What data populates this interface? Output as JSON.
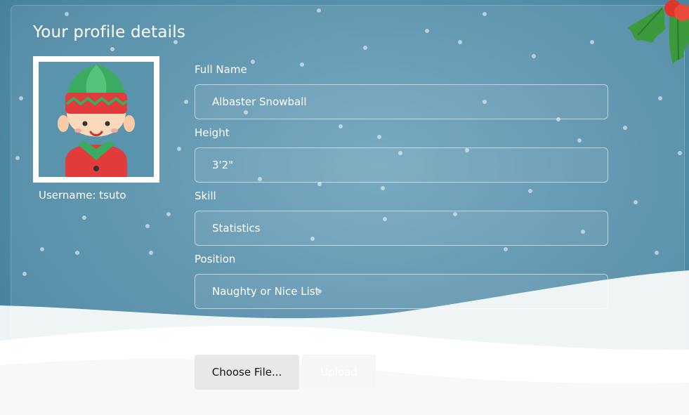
{
  "page": {
    "title": "Your profile details",
    "username_label": "Username: tsuto"
  },
  "avatar": {
    "icon": "elf-icon"
  },
  "fields": [
    {
      "label": "Full Name",
      "value": "Albaster Snowball"
    },
    {
      "label": "Height",
      "value": "3'2\""
    },
    {
      "label": "Skill",
      "value": "Statistics"
    },
    {
      "label": "Position",
      "value": "Naughty or Nice List"
    }
  ],
  "buttons": {
    "choose_file": "Choose File...",
    "upload": "Upload"
  },
  "decorations": {
    "corner": "holly-icon",
    "background": "snowy-hills"
  },
  "colors": {
    "sky": "#5790ab",
    "snow": "#ffffff",
    "holly_leaf": "#3c9a3c",
    "holly_berry": "#e0352b"
  }
}
